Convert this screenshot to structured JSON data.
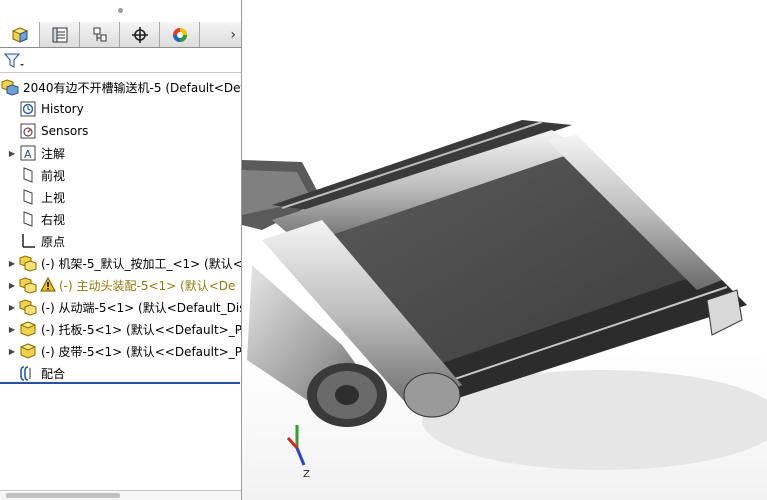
{
  "tabs": [
    {
      "icon": "feature-manager-icon",
      "active": true
    },
    {
      "icon": "property-manager-icon",
      "active": false
    },
    {
      "icon": "configuration-manager-icon",
      "active": false
    },
    {
      "icon": "dimxpert-icon",
      "active": false
    },
    {
      "icon": "display-manager-icon",
      "active": false
    }
  ],
  "tabs_more": "›",
  "tree": {
    "root": "2040有边不开槽输送机-5  (Default<Def",
    "items": [
      {
        "label": "History",
        "icon": "history-icon"
      },
      {
        "label": "Sensors",
        "icon": "sensors-icon"
      },
      {
        "label": "注解",
        "icon": "annotations-icon"
      },
      {
        "label": "前视",
        "icon": "plane-icon"
      },
      {
        "label": "上视",
        "icon": "plane-icon"
      },
      {
        "label": "右视",
        "icon": "plane-icon"
      },
      {
        "label": "原点",
        "icon": "origin-icon"
      },
      {
        "label": "(-) 机架-5_默认_按加工_<1> (默认<",
        "icon": "subassembly-icon"
      },
      {
        "label": "(-) 主动头装配-5<1> (默认<De",
        "icon": "subassembly-icon"
      },
      {
        "label": "(-) 从动端-5<1> (默认<Default_Dis",
        "icon": "subassembly-icon"
      },
      {
        "label": "(-) 托板-5<1> (默认<<Default>_Ph",
        "icon": "part-icon"
      },
      {
        "label": "(-) 皮带-5<1> (默认<<Default>_Ph",
        "icon": "part-icon"
      },
      {
        "label": "配合",
        "icon": "mates-icon"
      }
    ]
  },
  "colors": {
    "selection": "#27539e",
    "warning_text": "#8f7b10",
    "part_yellow": "#f2d24c"
  },
  "triad": {
    "z_label": "Z"
  }
}
